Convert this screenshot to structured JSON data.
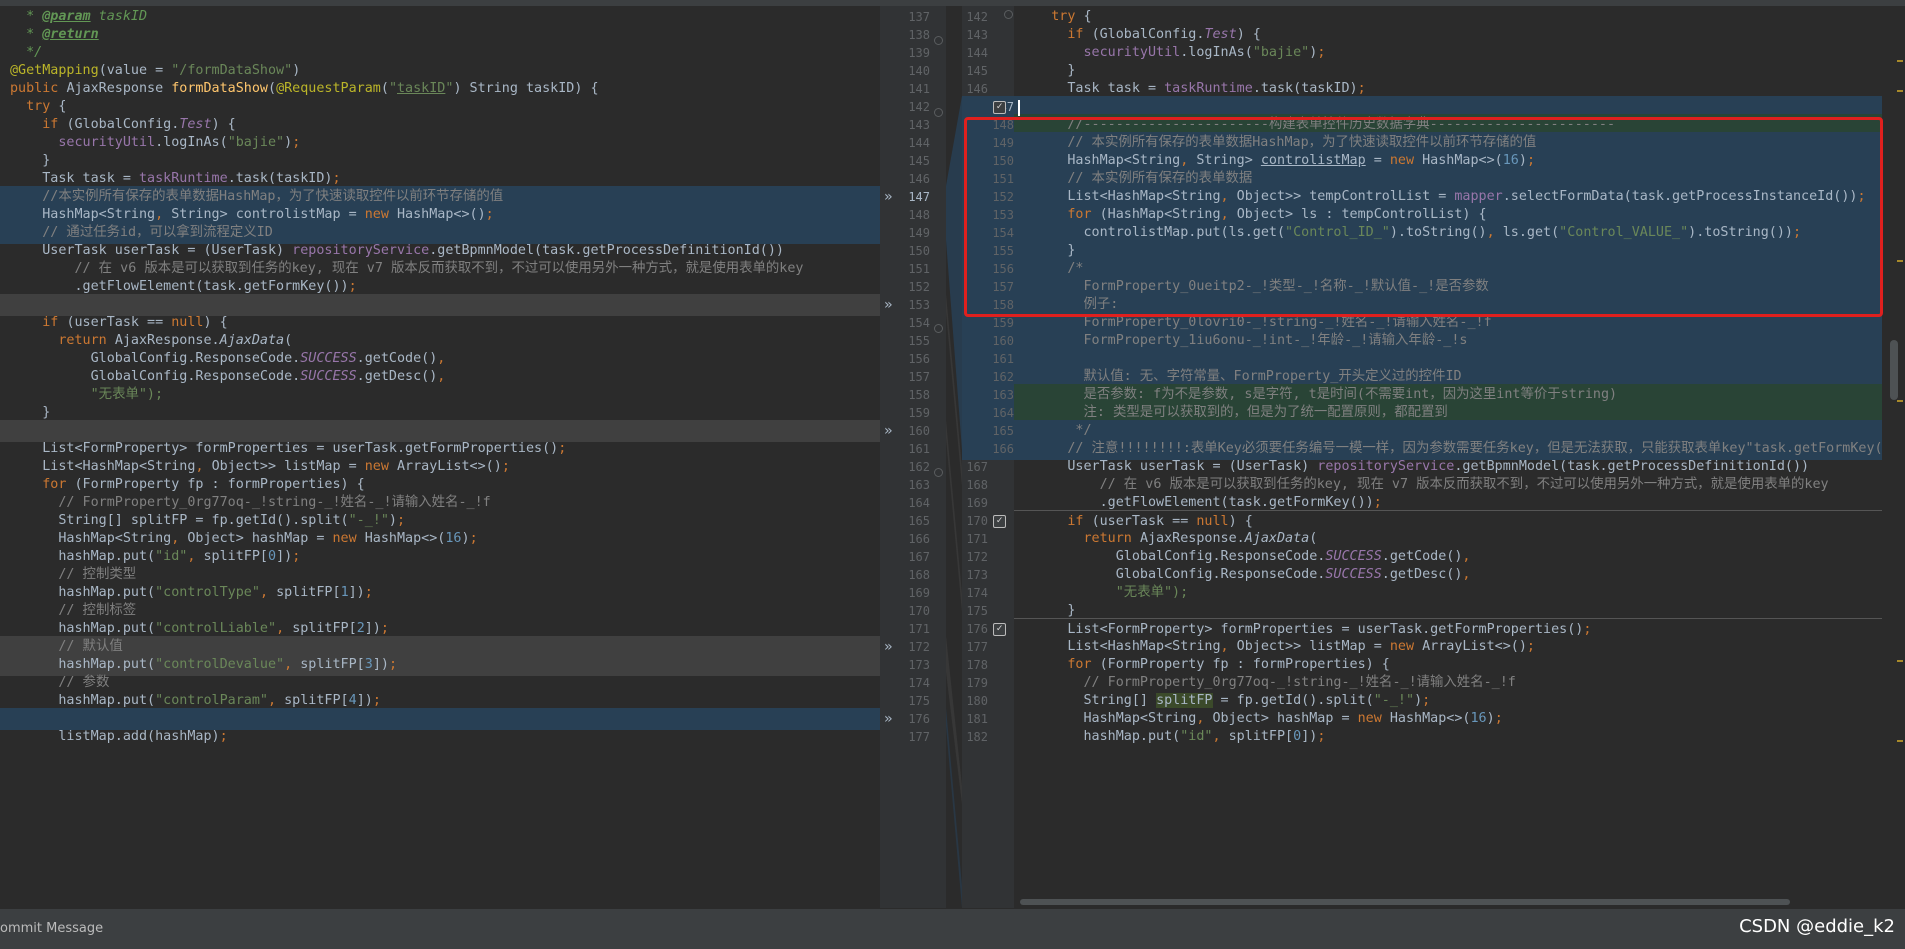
{
  "left": {
    "lines": [
      "  * @param taskID",
      "  * @return",
      "  */",
      "@GetMapping(value = \"/formDataShow\")",
      "public AjaxResponse formDataShow(@RequestParam(\"taskID\") String taskID) {",
      "  try {",
      "    if (GlobalConfig.Test) {",
      "      securityUtil.logInAs(\"bajie\");",
      "    }",
      "    Task task = taskRuntime.task(taskID);",
      "    //本实例所有保存的表单数据HashMap，为了快速读取控件以前环节存储的值",
      "    HashMap<String, String> controlistMap = new HashMap<>();",
      "    // 通过任务id，可以拿到流程定义ID",
      "    UserTask userTask = (UserTask) repositoryService.getBpmnModel(task.getProcessDefinitionId())",
      "        // 在 v6 版本是可以获取到任务的key, 现在 v7 版本反而获取不到，不过可以使用另外一种方式，就是使用表单的key",
      "        .getFlowElement(task.getFormKey());",
      "",
      "    if (userTask == null) {",
      "      return AjaxResponse.AjaxData(",
      "          GlobalConfig.ResponseCode.SUCCESS.getCode(),",
      "          GlobalConfig.ResponseCode.SUCCESS.getDesc(),",
      "          \"无表单\");",
      "    }",
      "",
      "    List<FormProperty> formProperties = userTask.getFormProperties();",
      "    List<HashMap<String, Object>> listMap = new ArrayList<>();",
      "    for (FormProperty fp : formProperties) {",
      "      // FormProperty_0rg77oq-_!string-_!姓名-_!请输入姓名-_!f",
      "      String[] splitFP = fp.getId().split(\"-_!\");",
      "      HashMap<String, Object> hashMap = new HashMap<>(16);",
      "      hashMap.put(\"id\", splitFP[0]);",
      "      // 控制类型",
      "      hashMap.put(\"controlType\", splitFP[1]);",
      "      // 控制标签",
      "      hashMap.put(\"controlLiable\", splitFP[2]);",
      "      // 默认值",
      "      hashMap.put(\"controlDevalue\", splitFP[3]);",
      "      // 参数",
      "      hashMap.put(\"controlParam\", splitFP[4]);",
      "",
      "      listMap.add(hashMap);"
    ],
    "line_numbers": [
      "137",
      "138",
      "139",
      "140",
      "141",
      "142",
      "143",
      "144",
      "145",
      "146",
      "147",
      "148",
      "149",
      "150",
      "151",
      "152",
      "153",
      "154",
      "155",
      "156",
      "157",
      "158",
      "159",
      "160",
      "161",
      "162",
      "163",
      "164",
      "165",
      "166",
      "167",
      "168",
      "169",
      "170",
      "171",
      "172",
      "173",
      "174",
      "175",
      "176",
      "177"
    ]
  },
  "right": {
    "lines": [
      "    try {",
      "      if (GlobalConfig.Test) {",
      "        securityUtil.logInAs(\"bajie\");",
      "      }",
      "      Task task = taskRuntime.task(taskID);",
      "",
      "      //-----------------------构建表单控件历史数据字典-----------------------",
      "      // 本实例所有保存的表单数据HashMap，为了快速读取控件以前环节存储的值",
      "      HashMap<String, String> controlistMap = new HashMap<>(16);",
      "      // 本实例所有保存的表单数据",
      "      List<HashMap<String, Object>> tempControlList = mapper.selectFormData(task.getProcessInstanceId());",
      "      for (HashMap<String, Object> ls : tempControlList) {",
      "        controlistMap.put(ls.get(\"Control_ID_\").toString(), ls.get(\"Control_VALUE_\").toString());",
      "      }",
      "      /*",
      "        FormProperty_0ueitp2-_!类型-_!名称-_!默认值-_!是否参数",
      "        例子:",
      "        FormProperty_0lovri0-_!string-_!姓名-_!请输入姓名-_!f",
      "        FormProperty_1iu6onu-_!int-_!年龄-_!请输入年龄-_!s",
      "",
      "        默认值: 无、字符常量、FormProperty_开头定义过的控件ID",
      "        是否参数: f为不是参数, s是字符, t是时间(不需要int，因为这里int等价于string)",
      "        注: 类型是可以获取到的，但是为了统一配置原则，都配置到",
      "       */",
      "      // 注意!!!!!!!!:表单Key必须要任务编号一模一样，因为参数需要任务key，但是无法获取，只能获取表单key\"task.getFormKey()\"当参数",
      "      UserTask userTask = (UserTask) repositoryService.getBpmnModel(task.getProcessDefinitionId())",
      "          // 在 v6 版本是可以获取到任务的key, 现在 v7 版本反而获取不到，不过可以使用另外一种方式，就是使用表单的key",
      "          .getFlowElement(task.getFormKey());",
      "      if (userTask == null) {",
      "        return AjaxResponse.AjaxData(",
      "            GlobalConfig.ResponseCode.SUCCESS.getCode(),",
      "            GlobalConfig.ResponseCode.SUCCESS.getDesc(),",
      "            \"无表单\");",
      "      }",
      "      List<FormProperty> formProperties = userTask.getFormProperties();",
      "      List<HashMap<String, Object>> listMap = new ArrayList<>();",
      "      for (FormProperty fp : formProperties) {",
      "        // FormProperty_0rg77oq-_!string-_!姓名-_!请输入姓名-_!f",
      "        String[] splitFP = fp.getId().split(\"-_!\");",
      "        HashMap<String, Object> hashMap = new HashMap<>(16);",
      "        hashMap.put(\"id\", splitFP[0]);"
    ],
    "line_numbers": [
      "142",
      "143",
      "144",
      "145",
      "146",
      "147",
      "148",
      "149",
      "150",
      "151",
      "152",
      "153",
      "154",
      "155",
      "156",
      "157",
      "158",
      "159",
      "160",
      "161",
      "162",
      "163",
      "164",
      "165",
      "166",
      "167",
      "168",
      "169",
      "170",
      "171",
      "172",
      "173",
      "174",
      "175",
      "176",
      "177",
      "178",
      "179",
      "180",
      "181",
      "182"
    ]
  },
  "merge_markers": {
    "arrow_glyph": "»",
    "left_numbers": [
      "147",
      "153",
      "160",
      "172",
      "176"
    ]
  },
  "status_bar": {
    "label": "ommit Message",
    "watermark": "CSDN @eddie_k2"
  },
  "colors": {
    "editor_bg": "#2b2b2b",
    "gutter_bg": "#313335",
    "changed_blue": "#284055",
    "changed_gray": "#404040",
    "inserted_green": "#294436",
    "annotation_red": "#e0201e"
  }
}
